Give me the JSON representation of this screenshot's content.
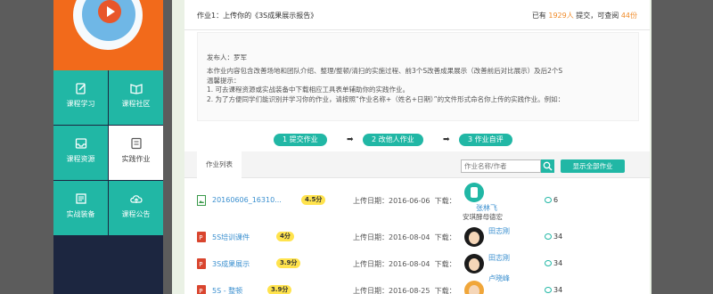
{
  "sidebar": {
    "items": [
      {
        "label": "课程学习",
        "icon": "edit-icon"
      },
      {
        "label": "课程社区",
        "icon": "book-icon"
      },
      {
        "label": "课程资源",
        "icon": "inbox-icon"
      },
      {
        "label": "实践作业",
        "icon": "notebook-icon",
        "active": true
      },
      {
        "label": "实战装备",
        "icon": "equipment-icon"
      },
      {
        "label": "课程公告",
        "icon": "cloud-upload-icon"
      }
    ]
  },
  "header": {
    "title": "作业1：上传你的《3S成果展示报告》",
    "stats_prefix": "已有",
    "submitted_count": "1929人",
    "stats_middle": "提交，可查阅",
    "viewable_count": "44份"
  },
  "description": {
    "publisher": "发布人：罗军",
    "lines": [
      "本作业内容包含改善场地和团队介绍、整理/整顿/清扫的实施过程、前3个S改善成果展示（改善前后对比展示）及后2个S",
      "温馨提示：",
      "1. 可去课程资源或实战装备中下载相应工具表单辅助你的实践作业。",
      "2. 为了方便同学们能识别并学习你的作业，请按照“作业名称+（姓名+日期）”的文件形式命名你上传的实践作业。例如："
    ]
  },
  "steps": [
    {
      "label": "1 提交作业"
    },
    {
      "label": "2 改他人作业"
    },
    {
      "label": "3 作业自评"
    }
  ],
  "list": {
    "tab_label": "作业列表",
    "search_placeholder": "作业名称/作者",
    "show_all_label": "显示全部作业",
    "download_label": "下载：",
    "rows": [
      {
        "file_name": "20160606_16310...",
        "file_type": "image",
        "score": "4.5分",
        "upload_date": "上传日期：2016-06-06",
        "user": "张林飞",
        "school": "安琪酵母德宏",
        "comments": "6"
      },
      {
        "file_name": "5S培训课件",
        "file_type": "ppt",
        "score": "4分",
        "upload_date": "上传日期：2016-08-04",
        "user": "田志刚",
        "school": "",
        "comments": "34"
      },
      {
        "file_name": "3S成果展示",
        "file_type": "ppt",
        "score": "3.9分",
        "upload_date": "上传日期：2016-08-04",
        "user": "田志刚",
        "school": "",
        "comments": "34"
      },
      {
        "file_name": "5S - 整顿",
        "file_type": "ppt",
        "score": "3.9分",
        "upload_date": "上传日期：2016-08-25",
        "user": "卢晓峰",
        "school": "",
        "comments": "34"
      }
    ]
  },
  "colors": {
    "teal": "#21b7a5",
    "orange": "#f26a1b",
    "score_yellow": "#ffe34d",
    "link_blue": "#3a8fcf"
  }
}
